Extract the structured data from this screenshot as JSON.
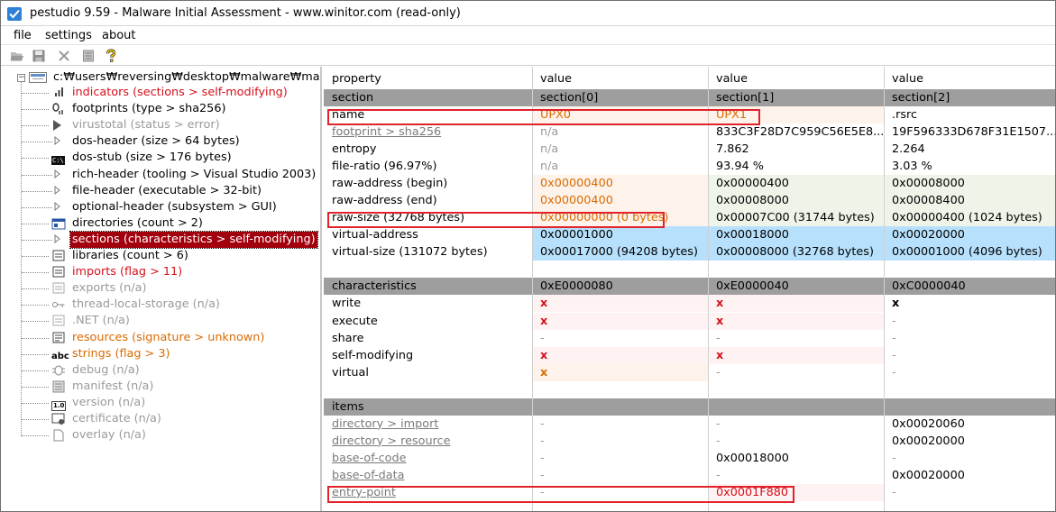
{
  "window": {
    "title": "pestudio 9.59 - Malware Initial Assessment - www.winitor.com (read-only)"
  },
  "menu": {
    "file": "file",
    "settings": "settings",
    "about": "about"
  },
  "tree": {
    "root": "c:₩users₩reversing₩desktop₩malware₩malware",
    "items": [
      {
        "label": "indicators (sections > self-modifying)",
        "icon": "indicators-icon",
        "style": "red"
      },
      {
        "label": "footprints (type > sha256)",
        "icon": "footprints-icon",
        "style": "normal"
      },
      {
        "label": "virustotal (status > error)",
        "icon": "virustotal-icon",
        "style": "gray"
      },
      {
        "label": "dos-header (size > 64 bytes)",
        "icon": "expand-arrow-icon",
        "style": "normal"
      },
      {
        "label": "dos-stub (size > 176 bytes)",
        "icon": "dos-stub-icon",
        "style": "normal"
      },
      {
        "label": "rich-header (tooling > Visual Studio 2003)",
        "icon": "expand-arrow-icon",
        "style": "normal"
      },
      {
        "label": "file-header (executable > 32-bit)",
        "icon": "expand-arrow-icon",
        "style": "normal"
      },
      {
        "label": "optional-header (subsystem > GUI)",
        "icon": "expand-arrow-icon",
        "style": "normal"
      },
      {
        "label": "directories (count > 2)",
        "icon": "directories-icon",
        "style": "normal"
      },
      {
        "label": "sections (characteristics > self-modifying)",
        "icon": "expand-arrow-icon",
        "style": "selected"
      },
      {
        "label": "libraries (count > 6)",
        "icon": "libraries-icon",
        "style": "normal"
      },
      {
        "label": "imports (flag > 11)",
        "icon": "imports-icon",
        "style": "red"
      },
      {
        "label": "exports (n/a)",
        "icon": "exports-icon",
        "style": "gray"
      },
      {
        "label": "thread-local-storage (n/a)",
        "icon": "tls-icon",
        "style": "gray"
      },
      {
        "label": ".NET (n/a)",
        "icon": "dotnet-icon",
        "style": "gray"
      },
      {
        "label": "resources (signature > unknown)",
        "icon": "resources-icon",
        "style": "orange"
      },
      {
        "label": "strings (flag > 3)",
        "icon": "strings-icon",
        "style": "orange"
      },
      {
        "label": "debug (n/a)",
        "icon": "debug-icon",
        "style": "gray"
      },
      {
        "label": "manifest (n/a)",
        "icon": "manifest-icon",
        "style": "gray"
      },
      {
        "label": "version (n/a)",
        "icon": "version-icon",
        "style": "gray"
      },
      {
        "label": "certificate (n/a)",
        "icon": "certificate-icon",
        "style": "gray"
      },
      {
        "label": "overlay (n/a)",
        "icon": "overlay-icon",
        "style": "gray"
      }
    ]
  },
  "icon_text": {
    "dos_stub": "C:\\",
    "strings": "abc",
    "version": "1.0"
  },
  "table": {
    "columns": [
      "property",
      "value",
      "value",
      "value"
    ],
    "rows": [
      {
        "kind": "header",
        "cells": [
          "section",
          "section[0]",
          "section[1]",
          "section[2]"
        ]
      },
      {
        "kind": "data",
        "cells": [
          "name",
          "UPX0",
          "UPX1",
          ".rsrc"
        ],
        "styles": [
          "",
          "orange",
          "orange",
          ""
        ],
        "bgs": [
          "",
          "peach",
          "peach",
          ""
        ]
      },
      {
        "kind": "data",
        "cells": [
          "footprint > sha256",
          "n/a",
          "833C3F28D7C959C56E5E8...",
          "19F596333D678F31E1507..."
        ],
        "styles": [
          "link",
          "gray",
          "",
          ""
        ],
        "bgs": [
          "",
          "",
          "",
          ""
        ]
      },
      {
        "kind": "data",
        "cells": [
          "entropy",
          "n/a",
          "7.862",
          "2.264"
        ],
        "styles": [
          "",
          "gray",
          "",
          ""
        ],
        "bgs": [
          "",
          "",
          "",
          ""
        ]
      },
      {
        "kind": "data",
        "cells": [
          "file-ratio (96.97%)",
          "n/a",
          "93.94 %",
          "3.03 %"
        ],
        "styles": [
          "",
          "gray",
          "",
          ""
        ],
        "bgs": [
          "",
          "",
          "",
          ""
        ]
      },
      {
        "kind": "data",
        "cells": [
          "raw-address (begin)",
          "0x00000400",
          "0x00000400",
          "0x00008000"
        ],
        "styles": [
          "",
          "orange",
          "",
          ""
        ],
        "bgs": [
          "",
          "peach",
          "green",
          "green"
        ]
      },
      {
        "kind": "data",
        "cells": [
          "raw-address (end)",
          "0x00000400",
          "0x00008000",
          "0x00008400"
        ],
        "styles": [
          "",
          "orange",
          "",
          ""
        ],
        "bgs": [
          "",
          "peach",
          "green",
          "green"
        ]
      },
      {
        "kind": "data",
        "cells": [
          "raw-size (32768 bytes)",
          "0x00000000 (0 bytes)",
          "0x00007C00 (31744 bytes)",
          "0x00000400 (1024 bytes)"
        ],
        "styles": [
          "",
          "orange",
          "",
          ""
        ],
        "bgs": [
          "",
          "peach",
          "green",
          "green"
        ]
      },
      {
        "kind": "data",
        "cells": [
          "virtual-address",
          "0x00001000",
          "0x00018000",
          "0x00020000"
        ],
        "styles": [
          "",
          "",
          "",
          ""
        ],
        "bgs": [
          "",
          "blue",
          "blue",
          "blue"
        ]
      },
      {
        "kind": "data",
        "cells": [
          "virtual-size (131072 bytes)",
          "0x00017000 (94208 bytes)",
          "0x00008000 (32768 bytes)",
          "0x00001000 (4096 bytes)"
        ],
        "styles": [
          "",
          "",
          "",
          ""
        ],
        "bgs": [
          "",
          "blue",
          "blue",
          "blue"
        ]
      },
      {
        "kind": "blank",
        "cells": [
          "",
          "",
          "",
          ""
        ]
      },
      {
        "kind": "header",
        "cells": [
          "characteristics",
          "0xE0000080",
          "0xE0000040",
          "0xC0000040"
        ]
      },
      {
        "kind": "data",
        "cells": [
          "write",
          "x",
          "x",
          "x"
        ],
        "styles": [
          "",
          "x",
          "x",
          "xk"
        ],
        "bgs": [
          "",
          "lpink",
          "lpink",
          ""
        ]
      },
      {
        "kind": "data",
        "cells": [
          "execute",
          "x",
          "x",
          "-"
        ],
        "styles": [
          "",
          "x",
          "x",
          "gray"
        ],
        "bgs": [
          "",
          "lpink",
          "lpink",
          ""
        ]
      },
      {
        "kind": "data",
        "cells": [
          "share",
          "-",
          "-",
          "-"
        ],
        "styles": [
          "",
          "gray",
          "gray",
          "gray"
        ],
        "bgs": [
          "",
          "",
          "",
          ""
        ]
      },
      {
        "kind": "data",
        "cells": [
          "self-modifying",
          "x",
          "x",
          "-"
        ],
        "styles": [
          "",
          "x",
          "x",
          "gray"
        ],
        "bgs": [
          "",
          "lpink",
          "lpink",
          ""
        ]
      },
      {
        "kind": "data",
        "cells": [
          "virtual",
          "x",
          "-",
          "-"
        ],
        "styles": [
          "",
          "xo",
          "gray",
          "gray"
        ],
        "bgs": [
          "",
          "peach",
          "",
          ""
        ]
      },
      {
        "kind": "blank",
        "cells": [
          "",
          "",
          "",
          ""
        ]
      },
      {
        "kind": "header",
        "cells": [
          "items",
          "",
          "",
          ""
        ]
      },
      {
        "kind": "data",
        "cells": [
          "directory > import",
          "-",
          "-",
          "0x00020060"
        ],
        "styles": [
          "link",
          "gray",
          "gray",
          ""
        ],
        "bgs": [
          "",
          "",
          "",
          ""
        ]
      },
      {
        "kind": "data",
        "cells": [
          "directory > resource",
          "-",
          "-",
          "0x00020000"
        ],
        "styles": [
          "link",
          "gray",
          "gray",
          ""
        ],
        "bgs": [
          "",
          "",
          "",
          ""
        ]
      },
      {
        "kind": "data",
        "cells": [
          "base-of-code",
          "-",
          "0x00018000",
          "-"
        ],
        "styles": [
          "link",
          "gray",
          "",
          "gray"
        ],
        "bgs": [
          "",
          "",
          "",
          ""
        ]
      },
      {
        "kind": "data",
        "cells": [
          "base-of-data",
          "-",
          "-",
          "0x00020000"
        ],
        "styles": [
          "link",
          "gray",
          "gray",
          ""
        ],
        "bgs": [
          "",
          "",
          "",
          ""
        ]
      },
      {
        "kind": "data",
        "cells": [
          "entry-point",
          "-",
          "0x0001F880",
          "-"
        ],
        "styles": [
          "link",
          "gray",
          "red",
          "gray"
        ],
        "bgs": [
          "",
          "",
          "lpink",
          ""
        ]
      }
    ]
  }
}
